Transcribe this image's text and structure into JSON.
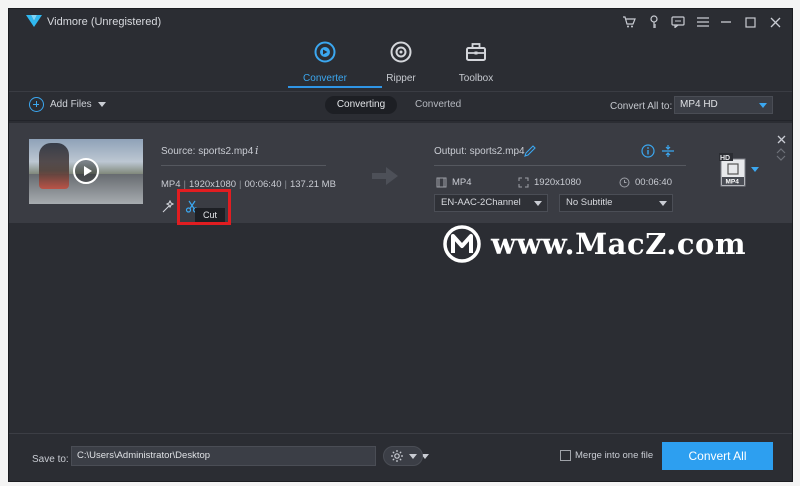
{
  "app": {
    "title": "Vidmore (Unregistered)"
  },
  "titlebar_icons": [
    "cart-icon",
    "key-icon",
    "feedback-icon",
    "menu-icon",
    "minimize-icon",
    "maximize-icon",
    "close-icon"
  ],
  "main_tabs": [
    {
      "label": "Converter",
      "icon": "converter-icon",
      "active": true
    },
    {
      "label": "Ripper",
      "icon": "disc-icon",
      "active": false
    },
    {
      "label": "Toolbox",
      "icon": "toolbox-icon",
      "active": false
    }
  ],
  "toolbar": {
    "add_files": "Add Files",
    "seg_converting": "Converting",
    "seg_converted": "Converted",
    "convert_all_to_label": "Convert All to:",
    "convert_all_to_value": "MP4 HD"
  },
  "item": {
    "source_label": "Source: sports2.mp4",
    "source_format": "MP4",
    "source_resolution": "1920x1080",
    "source_duration": "00:06:40",
    "source_size": "137.21 MB",
    "cut_tooltip": "Cut",
    "output_label": "Output: sports2.mp4",
    "output_format": "MP4",
    "output_resolution": "1920x1080",
    "output_duration": "00:06:40",
    "audio_track": "EN-AAC-2Channel",
    "subtitle": "No Subtitle",
    "format_tile_top": "HD",
    "format_tile_bottom": "MP4"
  },
  "watermark": {
    "text": "www.MacZ.com"
  },
  "bottom": {
    "save_to_label": "Save to:",
    "save_path": "C:\\Users\\Administrator\\Desktop",
    "merge_label": "Merge into one file",
    "merge_checked": false,
    "convert_all": "Convert All"
  },
  "colors": {
    "accent": "#2d9ff0",
    "highlight": "#e11d21",
    "background": "#2b2d33",
    "item_row": "#3a3c43"
  }
}
